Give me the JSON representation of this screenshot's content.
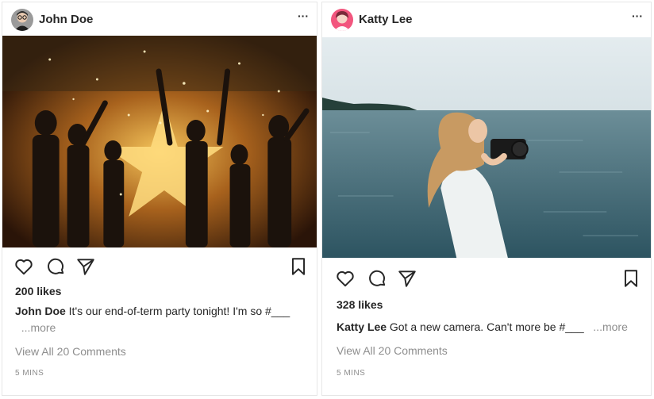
{
  "posts": [
    {
      "username": "John Doe",
      "more_label": "···",
      "avatar_icon": "user-avatar-glasses",
      "likes": "200 likes",
      "caption_user": "John Doe",
      "caption_text": " It's our end-of-term party tonight! I'm so #___",
      "caption_more": "...more",
      "view_comments": "View All 20 Comments",
      "time": "5 MINS",
      "image": "party-photo"
    },
    {
      "username": "Katty Lee",
      "more_label": "···",
      "avatar_icon": "user-avatar-pink",
      "likes": "328 likes",
      "caption_user": "Katty Lee",
      "caption_text": " Got a new camera. Can't more be #___",
      "caption_more": "...more",
      "view_comments": "View All 20 Comments",
      "time": "5 MINS",
      "image": "seaside-photographer-photo"
    }
  ],
  "icons": {
    "like": "heart-icon",
    "comment": "comment-icon",
    "share": "share-icon",
    "save": "bookmark-icon"
  },
  "colors": {
    "text": "#262626",
    "muted": "#8e8e8e",
    "border": "#e6e6e6"
  }
}
